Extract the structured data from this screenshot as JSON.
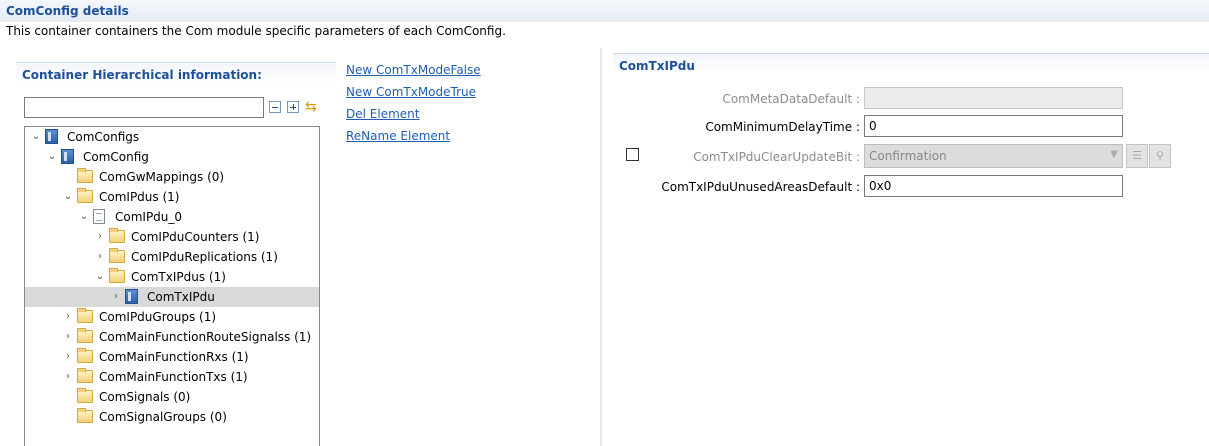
{
  "header": {
    "title": "ComConfig details",
    "description": "This container containers the Com module specific parameters of each ComConfig."
  },
  "left_panel": {
    "title": "Container Hierarchical information:",
    "filter": {
      "value": ""
    },
    "toolbar": {
      "collapse_icon": "collapse-all-icon",
      "expand_icon": "expand-all-icon",
      "sync_icon": "link-with-editor-icon"
    },
    "tree": [
      {
        "label": "ComConfigs",
        "icon": "container-icon",
        "expander": "expanded"
      },
      {
        "label": "ComConfig",
        "icon": "container-icon",
        "expander": "expanded"
      },
      {
        "label": "ComGwMappings (0)",
        "icon": "folder-icon",
        "expander": "none"
      },
      {
        "label": "ComIPdus (1)",
        "icon": "folder-icon",
        "expander": "expanded"
      },
      {
        "label": "ComIPdu_0",
        "icon": "document-icon",
        "expander": "expanded"
      },
      {
        "label": "ComIPduCounters (1)",
        "icon": "folder-icon",
        "expander": "collapsed"
      },
      {
        "label": "ComIPduReplications (1)",
        "icon": "folder-icon",
        "expander": "collapsed"
      },
      {
        "label": "ComTxIPdus (1)",
        "icon": "folder-icon",
        "expander": "expanded"
      },
      {
        "label": "ComTxIPdu",
        "icon": "container-icon",
        "expander": "collapsed",
        "selected": true
      },
      {
        "label": "ComIPduGroups (1)",
        "icon": "folder-icon",
        "expander": "collapsed"
      },
      {
        "label": "ComMainFunctionRouteSignalss (1)",
        "icon": "folder-icon",
        "expander": "collapsed"
      },
      {
        "label": "ComMainFunctionRxs (1)",
        "icon": "folder-icon",
        "expander": "collapsed"
      },
      {
        "label": "ComMainFunctionTxs (1)",
        "icon": "folder-icon",
        "expander": "collapsed"
      },
      {
        "label": "ComSignals (0)",
        "icon": "folder-icon",
        "expander": "none"
      },
      {
        "label": "ComSignalGroups (0)",
        "icon": "folder-icon",
        "expander": "none"
      }
    ]
  },
  "actions": {
    "new_false": "New ComTxModeFalse",
    "new_true": "New ComTxModeTrue",
    "delete": "Del Element",
    "rename": "ReName Element"
  },
  "right_panel": {
    "title": "ComTxIPdu",
    "fields": {
      "meta_default": {
        "label": "ComMetaDataDefault :",
        "value": "",
        "enabled": false
      },
      "min_delay": {
        "label": "ComMinimumDelayTime :",
        "value": "0",
        "enabled": true
      },
      "clear_update": {
        "label": "ComTxIPduClearUpdateBit :",
        "value": "Confirmation",
        "enabled": false,
        "checked": false
      },
      "unused_default": {
        "label": "ComTxIPduUnusedAreasDefault :",
        "value": "0x0",
        "enabled": true
      }
    }
  }
}
